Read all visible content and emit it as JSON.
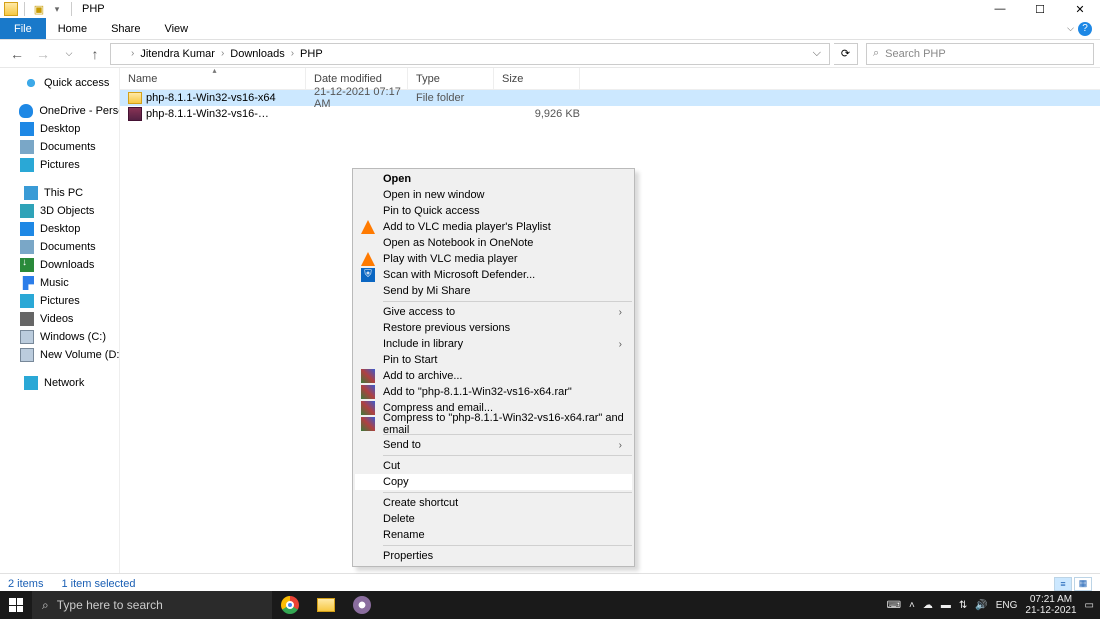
{
  "title": "PHP",
  "ribbon": {
    "file": "File",
    "home": "Home",
    "share": "Share",
    "view": "View"
  },
  "breadcrumb": [
    "Jitendra Kumar",
    "Downloads",
    "PHP"
  ],
  "search_placeholder": "Search PHP",
  "columns": {
    "name": "Name",
    "date": "Date modified",
    "type": "Type",
    "size": "Size"
  },
  "rows": [
    {
      "name": "php-8.1.1-Win32-vs16-x64",
      "date": "21-12-2021 07:17 AM",
      "type": "File folder",
      "size": "",
      "icon": "folder",
      "selected": true
    },
    {
      "name": "php-8.1.1-Win32-vs16-…",
      "date": "",
      "type": "",
      "size": "9,926 KB",
      "icon": "rar",
      "selected": false
    }
  ],
  "sidebar": {
    "quick": "Quick access",
    "onedrive": "OneDrive - Personal",
    "od_items": [
      "Desktop",
      "Documents",
      "Pictures"
    ],
    "thispc": "This PC",
    "pc_items": [
      "3D Objects",
      "Desktop",
      "Documents",
      "Downloads",
      "Music",
      "Pictures",
      "Videos",
      "Windows (C:)",
      "New Volume (D:)"
    ],
    "network": "Network"
  },
  "context": {
    "open": "Open",
    "open_new": "Open in new window",
    "pin_qa": "Pin to Quick access",
    "vlc_add": "Add to VLC media player's Playlist",
    "onenote": "Open as Notebook in OneNote",
    "vlc_play": "Play with VLC media player",
    "defender": "Scan with Microsoft Defender...",
    "mishare": "Send by Mi Share",
    "give_access": "Give access to",
    "restore": "Restore previous versions",
    "include_lib": "Include in library",
    "pin_start": "Pin to Start",
    "add_archive": "Add to archive...",
    "add_to_rar": "Add to \"php-8.1.1-Win32-vs16-x64.rar\"",
    "compress_email": "Compress and email...",
    "compress_to_email": "Compress to \"php-8.1.1-Win32-vs16-x64.rar\" and email",
    "send_to": "Send to",
    "cut": "Cut",
    "copy": "Copy",
    "shortcut": "Create shortcut",
    "delete": "Delete",
    "rename": "Rename",
    "properties": "Properties"
  },
  "status": {
    "items": "2 items",
    "selected": "1 item selected"
  },
  "taskbar": {
    "search": "Type here to search",
    "lang": "ENG",
    "time": "07:21 AM",
    "date": "21-12-2021"
  }
}
